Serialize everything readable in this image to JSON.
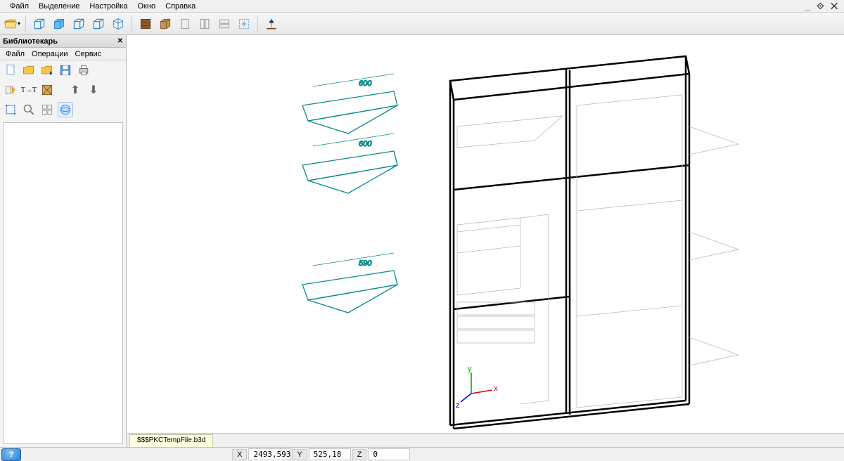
{
  "menu": {
    "items": [
      "Файл",
      "Выделение",
      "Настройка",
      "Окно",
      "Справка"
    ]
  },
  "panel": {
    "title": "Библиотекарь",
    "menu": [
      "Файл",
      "Операции",
      "Сервис"
    ]
  },
  "tabs": {
    "active": "$$$PKCTempFile.b3d"
  },
  "coords": {
    "x_label": "X",
    "x": "2493,593",
    "y_label": "Y",
    "y": "525,18",
    "z_label": "Z",
    "z": "0"
  },
  "dims": {
    "a": "600",
    "b": "600",
    "c": "590"
  },
  "window_controls": "_ ⟐ ✕"
}
